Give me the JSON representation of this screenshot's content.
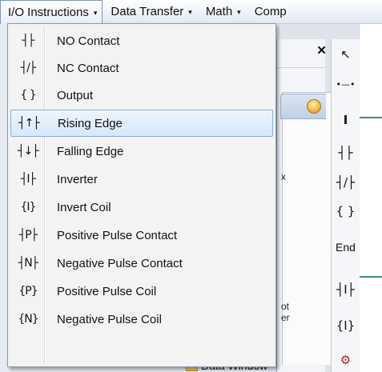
{
  "menubar": {
    "items": [
      {
        "label": "I/O Instructions",
        "caret": "▾"
      },
      {
        "label": "Data Transfer",
        "caret": "▾"
      },
      {
        "label": "Math",
        "caret": "▾"
      },
      {
        "label": "Comp",
        "caret": ""
      }
    ]
  },
  "dropdown": {
    "items": [
      {
        "icon": "┤├",
        "label": "NO Contact"
      },
      {
        "icon": "┤/├",
        "label": "NC Contact"
      },
      {
        "icon": "{ }",
        "label": "Output"
      },
      {
        "icon": "┤↑├",
        "label": "Rising Edge"
      },
      {
        "icon": "┤↓├",
        "label": "Falling Edge"
      },
      {
        "icon": "┤I├",
        "label": "Inverter"
      },
      {
        "icon": "{I}",
        "label": "Invert Coil"
      },
      {
        "icon": "┤P├",
        "label": "Positive Pulse Contact"
      },
      {
        "icon": "┤N├",
        "label": "Negative Pulse Contact"
      },
      {
        "icon": "{P}",
        "label": "Positive Pulse Coil"
      },
      {
        "icon": "{N}",
        "label": "Negative Pulse Coil"
      }
    ],
    "highlighted_index": 3
  },
  "window": {
    "close_glyph": "×",
    "fragments": [
      "x",
      "ot",
      "er"
    ]
  },
  "toolbar": {
    "tools": [
      {
        "glyph": "↖",
        "name": "select-pointer-icon"
      },
      {
        "glyph": "•—•",
        "name": "horizontal-wire-icon"
      },
      {
        "glyph": "I",
        "name": "vertical-wire-icon"
      },
      {
        "glyph": "┤├",
        "name": "no-contact-tool-icon"
      },
      {
        "glyph": "┤/├",
        "name": "nc-contact-tool-icon"
      },
      {
        "glyph": "{ }",
        "name": "output-tool-icon"
      },
      {
        "glyph": "End",
        "name": "end-tool-icon"
      },
      {
        "glyph": "┤I├",
        "name": "inverter-tool-icon"
      },
      {
        "glyph": "{I}",
        "name": "invert-coil-tool-icon"
      },
      {
        "glyph": "⚙",
        "name": "gear-tool-icon"
      }
    ]
  },
  "bottom": {
    "data_window_label": "Data Window"
  },
  "colors": {
    "highlight_border": "#84acdd",
    "highlight_fill": "#d6e8fb",
    "accent_teal": "#3d8a8a"
  }
}
